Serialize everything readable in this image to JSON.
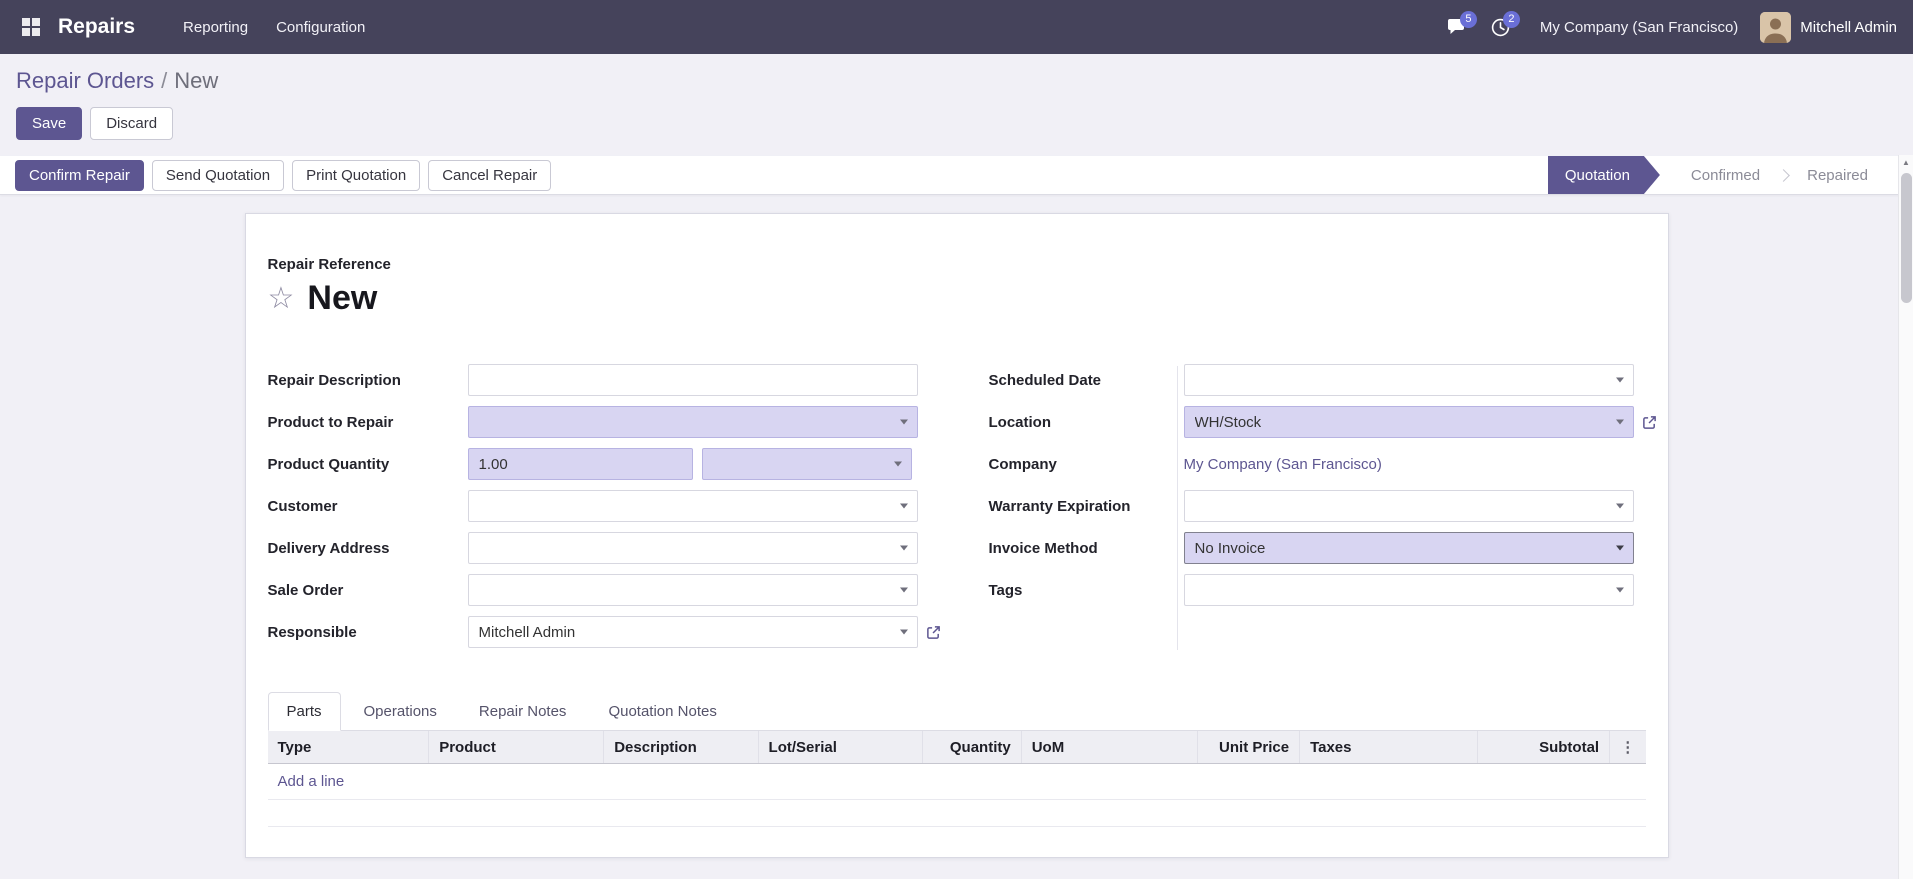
{
  "colors": {
    "navbar-bg": "#45435b",
    "primary": "#5d5691",
    "link": "#5d5691",
    "body-bg": "#f1f0f6",
    "required-bg": "#d8d5f2",
    "badge-bg": "#6a6fd6"
  },
  "navbar": {
    "app_name": "Repairs",
    "menus": [
      "Reporting",
      "Configuration"
    ],
    "messages_count": "5",
    "activities_count": "2",
    "company": "My Company (San Francisco)",
    "user": "Mitchell Admin"
  },
  "breadcrumb": {
    "parent": "Repair Orders",
    "separator": "/",
    "current": "New"
  },
  "header_actions": {
    "save": "Save",
    "discard": "Discard"
  },
  "statusbar": {
    "buttons": {
      "confirm": "Confirm Repair",
      "send": "Send Quotation",
      "print": "Print Quotation",
      "cancel": "Cancel Repair"
    },
    "steps": [
      {
        "label": "Quotation",
        "active": true
      },
      {
        "label": "Confirmed",
        "active": false
      },
      {
        "label": "Repaired",
        "active": false
      }
    ]
  },
  "form": {
    "reference_label": "Repair Reference",
    "reference_value": "New",
    "fields": {
      "repair_description": {
        "label": "Repair Description",
        "value": ""
      },
      "product_to_repair": {
        "label": "Product to Repair",
        "value": ""
      },
      "product_quantity": {
        "label": "Product Quantity",
        "value": "1.00",
        "uom_value": ""
      },
      "customer": {
        "label": "Customer",
        "value": ""
      },
      "delivery_address": {
        "label": "Delivery Address",
        "value": ""
      },
      "sale_order": {
        "label": "Sale Order",
        "value": ""
      },
      "responsible": {
        "label": "Responsible",
        "value": "Mitchell Admin"
      },
      "scheduled_date": {
        "label": "Scheduled Date",
        "value": ""
      },
      "location": {
        "label": "Location",
        "value": "WH/Stock"
      },
      "company": {
        "label": "Company",
        "value": "My Company (San Francisco)"
      },
      "warranty_expiration": {
        "label": "Warranty Expiration",
        "value": ""
      },
      "invoice_method": {
        "label": "Invoice Method",
        "value": "No Invoice"
      },
      "tags": {
        "label": "Tags",
        "value": ""
      }
    },
    "tabs": [
      {
        "label": "Parts",
        "active": true
      },
      {
        "label": "Operations",
        "active": false
      },
      {
        "label": "Repair Notes",
        "active": false
      },
      {
        "label": "Quotation Notes",
        "active": false
      }
    ],
    "parts_table": {
      "columns": [
        "Type",
        "Product",
        "Description",
        "Lot/Serial",
        "Quantity",
        "UoM",
        "Unit Price",
        "Taxes",
        "Subtotal"
      ],
      "options_icon": "⋮",
      "add_line_label": "Add a line"
    }
  }
}
